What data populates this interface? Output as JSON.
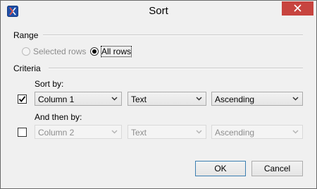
{
  "window": {
    "title": "Sort"
  },
  "range": {
    "label": "Range",
    "options": [
      {
        "label": "Selected rows",
        "selected": false,
        "enabled": false
      },
      {
        "label": "All rows",
        "selected": true,
        "enabled": true
      }
    ]
  },
  "criteria": {
    "label": "Criteria",
    "sort_by": {
      "label": "Sort by:",
      "checked": true,
      "column": "Column 1",
      "type": "Text",
      "order": "Ascending"
    },
    "then_by": {
      "label": "And then by:",
      "checked": false,
      "column": "Column 2",
      "type": "Text",
      "order": "Ascending"
    }
  },
  "buttons": {
    "ok": "OK",
    "cancel": "Cancel"
  },
  "colors": {
    "close_button": "#c7443f",
    "app_icon": "#1f4fa8",
    "default_button_border": "#3c7fb1"
  }
}
